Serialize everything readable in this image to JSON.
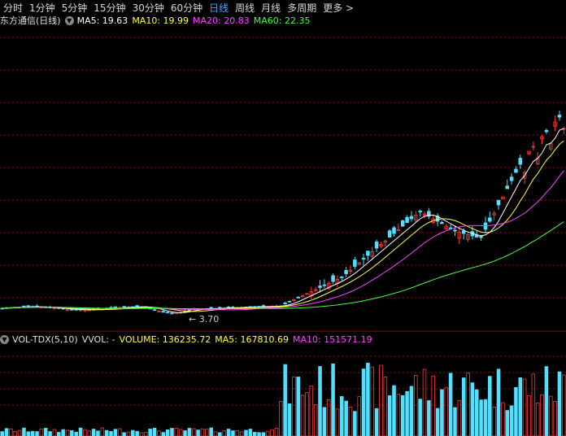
{
  "period_tabs": [
    {
      "label": "分时"
    },
    {
      "label": "1分钟"
    },
    {
      "label": "5分钟"
    },
    {
      "label": "15分钟"
    },
    {
      "label": "30分钟"
    },
    {
      "label": "60分钟"
    },
    {
      "label": "日线",
      "active": true
    },
    {
      "label": "周线"
    },
    {
      "label": "月线"
    },
    {
      "label": "多周期"
    },
    {
      "label": "更多 >"
    }
  ],
  "chart": {
    "title": "东方通信(日线)",
    "ma5": "MA5: 19.63",
    "ma10": "MA10: 19.99",
    "ma20": "MA20: 20.83",
    "ma60": "MA60: 22.35",
    "low_label": "3.70"
  },
  "volume": {
    "indicator": "VOL-TDX(5,10)",
    "vvol": "VVOL: -",
    "volume": "VOLUME: 136235.72",
    "ma5": "MA5: 167810.69",
    "ma10": "MA10: 151571.19"
  },
  "colors": {
    "up": "#ff3b3b",
    "down": "#4fe0ff",
    "ma5": "#ffffff",
    "ma10": "#ffff44",
    "ma20": "#ff44ff",
    "ma60": "#44ff44",
    "grid": "#8a0f0f",
    "active_tab": "#3fa7ff"
  }
}
